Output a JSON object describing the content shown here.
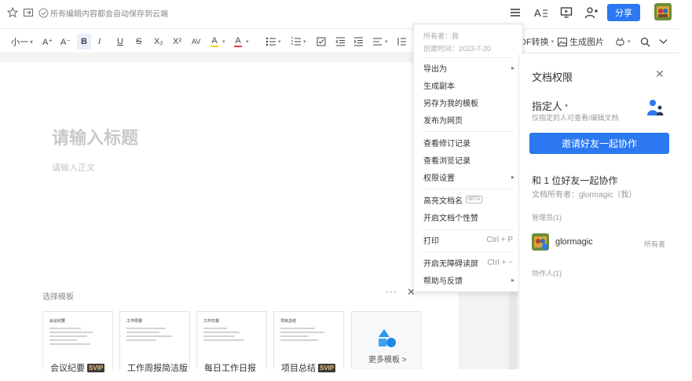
{
  "topbar": {
    "save_status": "所有编辑内容都会自动保存到云端",
    "share_label": "分享",
    "icons": [
      "star-icon",
      "move-to-folder-icon",
      "cloud-saved-icon",
      "menu-icon",
      "font-style-icon",
      "present-icon",
      "add-user-icon"
    ]
  },
  "toolbar": {
    "font_size": "小一",
    "font_grow": "A⁺",
    "font_shrink": "A⁻",
    "bold": "B",
    "italic": "I",
    "underline": "U",
    "strike": "S",
    "subscript": "X₂",
    "superscript": "X²",
    "char_spacing": "AV",
    "highlight": "A",
    "font_color": "A",
    "pdf_convert": "DF转换",
    "gen_image": "生成图片"
  },
  "editor": {
    "title_placeholder": "请输入标题",
    "body_placeholder": "请输入正文"
  },
  "templates": {
    "label": "选择模板",
    "more_dots": "···",
    "close": "✕",
    "items": [
      {
        "name": "会议纪要",
        "svip": "SVIP",
        "heading": "会议纪要"
      },
      {
        "name": "工作周报简洁版",
        "svip": "",
        "heading": "工作周报"
      },
      {
        "name": "每日工作日报",
        "svip": "",
        "heading": "工作日报"
      },
      {
        "name": "项目总结",
        "svip": "SVIP",
        "heading": "项目总结"
      }
    ],
    "more_label": "更多模板 >"
  },
  "menu": {
    "owner_line": "所有者：我",
    "created_line": "创建时间：2023-7-20",
    "items": [
      {
        "label": "导出为",
        "arrow": "▸",
        "shortcut": ""
      },
      {
        "label": "生成副本",
        "arrow": "",
        "shortcut": ""
      },
      {
        "label": "另存为我的模板",
        "arrow": "",
        "shortcut": ""
      },
      {
        "label": "发布为网页",
        "arrow": "",
        "shortcut": ""
      },
      {
        "label": "查看修订记录",
        "arrow": "",
        "shortcut": ""
      },
      {
        "label": "查看浏览记录",
        "arrow": "",
        "shortcut": ""
      },
      {
        "label": "权限设置",
        "arrow": "▸",
        "shortcut": ""
      },
      {
        "label": "高亮文档名",
        "arrow": "",
        "shortcut": "",
        "badge": "BETA"
      },
      {
        "label": "开启文档个性赞",
        "arrow": "",
        "shortcut": ""
      },
      {
        "label": "打印",
        "arrow": "",
        "shortcut": "Ctrl + P"
      },
      {
        "label": "开启无障碍读屏",
        "arrow": "",
        "shortcut": "Ctrl + ~"
      },
      {
        "label": "帮助与反馈",
        "arrow": "▸",
        "shortcut": ""
      }
    ]
  },
  "panel": {
    "title": "文档权限",
    "close": "✕",
    "owner_select": "指定人",
    "owner_desc": "仅指定的人可查看/编辑文档",
    "invite_button": "邀请好友一起协作",
    "collab_title": "和 1 位好友一起协作",
    "collab_owner": "文档所有者：glormagic（我）",
    "admins_label": "管理员(1)",
    "admin_name": "glormagic",
    "admin_role": "所有者",
    "collaborators_label": "协作人(1)"
  },
  "colors": {
    "accent": "#2b78f0",
    "highlight_bar": "#f5d400",
    "font_color_bar": "#e33b3b"
  }
}
